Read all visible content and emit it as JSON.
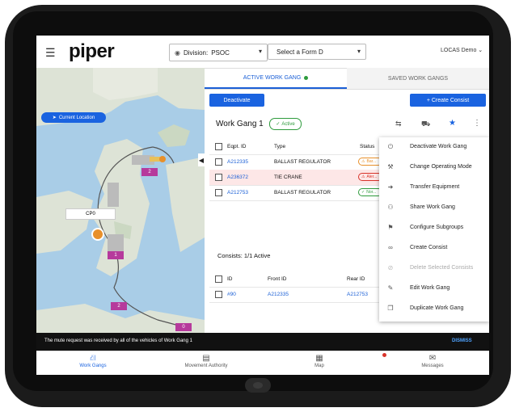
{
  "app": {
    "logo": "piper",
    "user": "LOCAS Demo ⌄"
  },
  "header": {
    "division_label": "Division:",
    "division_value": "PSOC",
    "form_placeholder": "Select a Form D"
  },
  "map": {
    "current_location_label": "Current Location",
    "markers": [
      {
        "label": "CP0"
      },
      {
        "label": "2"
      },
      {
        "label": "1"
      },
      {
        "label": "2"
      },
      {
        "label": "0"
      }
    ]
  },
  "tabs": {
    "active": "ACTIVE WORK GANG",
    "saved": "SAVED WORK GANGS"
  },
  "toolbar": {
    "deactivate": "Deactivate",
    "create_consist": "+  Create Consist"
  },
  "work_gang": {
    "title": "Work Gang 1",
    "status_badge": "Active",
    "columns": [
      "Eqpt. ID",
      "Type",
      "Status"
    ],
    "rows": [
      {
        "id": "A212335",
        "type": "BALLAST REGULATOR",
        "status": "Bar..."
      },
      {
        "id": "A236372",
        "type": "TIE CRANE",
        "status": "Aler..."
      },
      {
        "id": "A212753",
        "type": "BALLAST REGULATOR",
        "status": "Nor..."
      }
    ],
    "status_colors": {
      "warning": "#e8902a",
      "alert": "#d9342b",
      "normal": "#2e9b3c"
    }
  },
  "consists": {
    "title": "Consists: 1/1 Active",
    "columns": [
      "ID",
      "Front ID",
      "Rear ID"
    ],
    "rows": [
      {
        "id": "#90",
        "front": "A212335",
        "rear": "A212753"
      }
    ]
  },
  "menu": {
    "items": [
      {
        "label": "Deactivate Work Gang",
        "icon": "power-icon",
        "disabled": false
      },
      {
        "label": "Change Operating Mode",
        "icon": "mode-icon",
        "disabled": false
      },
      {
        "label": "Transfer Equipment",
        "icon": "transfer-icon",
        "disabled": false
      },
      {
        "label": "Share Work Gang",
        "icon": "share-icon",
        "disabled": false
      },
      {
        "label": "Configure Subgroups",
        "icon": "subgroups-icon",
        "disabled": false
      },
      {
        "label": "Create Consist",
        "icon": "link-icon",
        "disabled": false
      },
      {
        "label": "Delete Selected Consists",
        "icon": "unlink-icon",
        "disabled": true
      },
      {
        "label": "Edit Work Gang",
        "icon": "pencil-icon",
        "disabled": false
      },
      {
        "label": "Duplicate Work Gang",
        "icon": "copy-icon",
        "disabled": false
      }
    ]
  },
  "snackbar": {
    "message": "The mute request was received by all of the vehicles of Work Gang 1",
    "action": "DISMISS"
  },
  "bottom_nav": [
    {
      "label": "Work Gangs",
      "icon": "work-gangs-icon",
      "active": true
    },
    {
      "label": "Movement Authority",
      "icon": "movement-authority-icon",
      "active": false
    },
    {
      "label": "Map",
      "icon": "map-icon",
      "active": false
    },
    {
      "label": "Messages",
      "icon": "messages-icon",
      "active": false
    }
  ],
  "colors": {
    "accent": "#1a63e0",
    "marker": "#b63a9c",
    "active_green": "#2e9b3c",
    "snackbar_action": "#4fa3ff"
  }
}
